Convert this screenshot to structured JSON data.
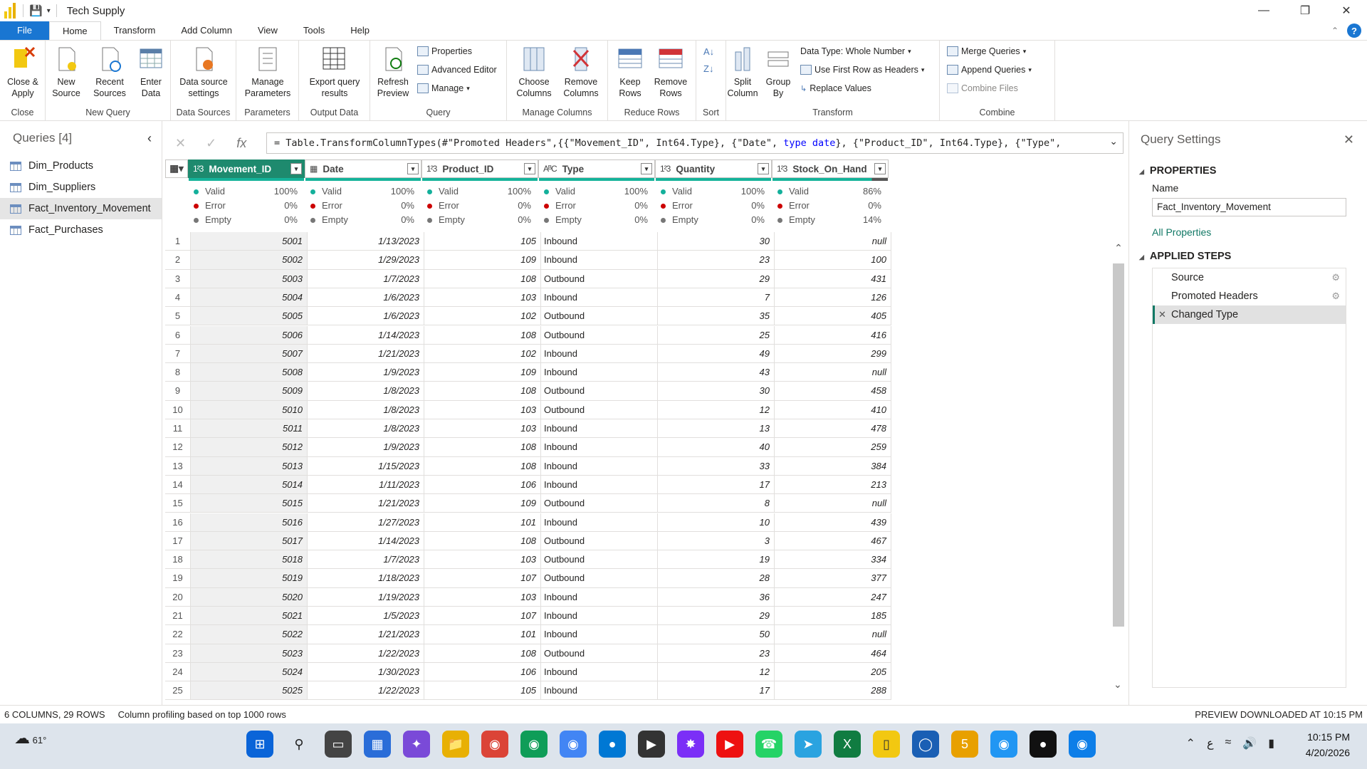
{
  "title": "Tech Supply",
  "menu": {
    "file": "File",
    "tabs": [
      "Home",
      "Transform",
      "Add Column",
      "View",
      "Tools",
      "Help"
    ]
  },
  "ribbon": {
    "close_apply": "Close & Apply",
    "new_source": "New Source",
    "recent_sources": "Recent Sources",
    "enter_data": "Enter Data",
    "data_source_settings": "Data source settings",
    "manage_parameters": "Manage Parameters",
    "export_query": "Export query results",
    "refresh_preview": "Refresh Preview",
    "properties": "Properties",
    "advanced_editor": "Advanced Editor",
    "manage": "Manage",
    "choose_columns": "Choose Columns",
    "remove_columns": "Remove Columns",
    "keep_rows": "Keep Rows",
    "remove_rows": "Remove Rows",
    "split_column": "Split Column",
    "group_by": "Group By",
    "data_type": "Data Type: Whole Number",
    "first_row_headers": "Use First Row as Headers",
    "replace_values": "Replace Values",
    "merge_queries": "Merge Queries",
    "append_queries": "Append Queries",
    "combine_files": "Combine Files",
    "groups": [
      "Close",
      "New Query",
      "Data Sources",
      "Parameters",
      "Output Data",
      "Query",
      "Manage Columns",
      "Reduce Rows",
      "Sort",
      "Transform",
      "Combine"
    ]
  },
  "queries": {
    "header": "Queries [4]",
    "items": [
      "Dim_Products",
      "Dim_Suppliers",
      "Fact_Inventory_Movement",
      "Fact_Purchases"
    ],
    "selected": "Fact_Inventory_Movement"
  },
  "formula": {
    "prefix": "= Table.TransformColumnTypes(#\"Promoted Headers\",{{\"Movement_ID\", Int64.Type}, {\"Date\", ",
    "kw1": "type",
    "mid": " ",
    "kw2": "date",
    "suffix": "}, {\"Product_ID\", Int64.Type}, {\"Type\","
  },
  "columns": [
    {
      "name": "Movement_ID",
      "type": "1²3",
      "valid": "100%",
      "error": "0%",
      "empty": "0%"
    },
    {
      "name": "Date",
      "type": "▦",
      "valid": "100%",
      "error": "0%",
      "empty": "0%"
    },
    {
      "name": "Product_ID",
      "type": "1²3",
      "valid": "100%",
      "error": "0%",
      "empty": "0%"
    },
    {
      "name": "Type",
      "type": "AᴮC",
      "valid": "100%",
      "error": "0%",
      "empty": "0%"
    },
    {
      "name": "Quantity",
      "type": "1²3",
      "valid": "100%",
      "error": "0%",
      "empty": "0%"
    },
    {
      "name": "Stock_On_Hand",
      "type": "1²3",
      "valid": "86%",
      "error": "0%",
      "empty": "14%"
    }
  ],
  "profile_labels": {
    "valid": "Valid",
    "error": "Error",
    "empty": "Empty"
  },
  "rows": [
    [
      "1",
      "5001",
      "1/13/2023",
      "105",
      "Inbound",
      "30",
      "null"
    ],
    [
      "2",
      "5002",
      "1/29/2023",
      "109",
      "Inbound",
      "23",
      "100"
    ],
    [
      "3",
      "5003",
      "1/7/2023",
      "108",
      "Outbound",
      "29",
      "431"
    ],
    [
      "4",
      "5004",
      "1/6/2023",
      "103",
      "Inbound",
      "7",
      "126"
    ],
    [
      "5",
      "5005",
      "1/6/2023",
      "102",
      "Outbound",
      "35",
      "405"
    ],
    [
      "6",
      "5006",
      "1/14/2023",
      "108",
      "Outbound",
      "25",
      "416"
    ],
    [
      "7",
      "5007",
      "1/21/2023",
      "102",
      "Inbound",
      "49",
      "299"
    ],
    [
      "8",
      "5008",
      "1/9/2023",
      "109",
      "Inbound",
      "43",
      "null"
    ],
    [
      "9",
      "5009",
      "1/8/2023",
      "108",
      "Outbound",
      "30",
      "458"
    ],
    [
      "10",
      "5010",
      "1/8/2023",
      "103",
      "Outbound",
      "12",
      "410"
    ],
    [
      "11",
      "5011",
      "1/8/2023",
      "103",
      "Inbound",
      "13",
      "478"
    ],
    [
      "12",
      "5012",
      "1/9/2023",
      "108",
      "Inbound",
      "40",
      "259"
    ],
    [
      "13",
      "5013",
      "1/15/2023",
      "108",
      "Inbound",
      "33",
      "384"
    ],
    [
      "14",
      "5014",
      "1/11/2023",
      "106",
      "Inbound",
      "17",
      "213"
    ],
    [
      "15",
      "5015",
      "1/21/2023",
      "109",
      "Outbound",
      "8",
      "null"
    ],
    [
      "16",
      "5016",
      "1/27/2023",
      "101",
      "Inbound",
      "10",
      "439"
    ],
    [
      "17",
      "5017",
      "1/14/2023",
      "108",
      "Outbound",
      "3",
      "467"
    ],
    [
      "18",
      "5018",
      "1/7/2023",
      "103",
      "Outbound",
      "19",
      "334"
    ],
    [
      "19",
      "5019",
      "1/18/2023",
      "107",
      "Outbound",
      "28",
      "377"
    ],
    [
      "20",
      "5020",
      "1/19/2023",
      "103",
      "Inbound",
      "36",
      "247"
    ],
    [
      "21",
      "5021",
      "1/5/2023",
      "107",
      "Inbound",
      "29",
      "185"
    ],
    [
      "22",
      "5022",
      "1/21/2023",
      "101",
      "Inbound",
      "50",
      "null"
    ],
    [
      "23",
      "5023",
      "1/22/2023",
      "108",
      "Outbound",
      "23",
      "464"
    ],
    [
      "24",
      "5024",
      "1/30/2023",
      "106",
      "Inbound",
      "12",
      "205"
    ],
    [
      "25",
      "5025",
      "1/22/2023",
      "105",
      "Inbound",
      "17",
      "288"
    ]
  ],
  "settings": {
    "header": "Query Settings",
    "properties": "PROPERTIES",
    "name_label": "Name",
    "name_value": "Fact_Inventory_Movement",
    "all_properties": "All Properties",
    "applied_steps": "APPLIED STEPS",
    "steps": [
      "Source",
      "Promoted Headers",
      "Changed Type"
    ]
  },
  "status": {
    "left1": "6 COLUMNS, 29 ROWS",
    "left2": "Column profiling based on top 1000 rows",
    "right": "PREVIEW DOWNLOADED AT 10:15 PM"
  },
  "taskbar": {
    "temp": "61°",
    "time": "10:15 PM",
    "date": "4/20/2026"
  }
}
